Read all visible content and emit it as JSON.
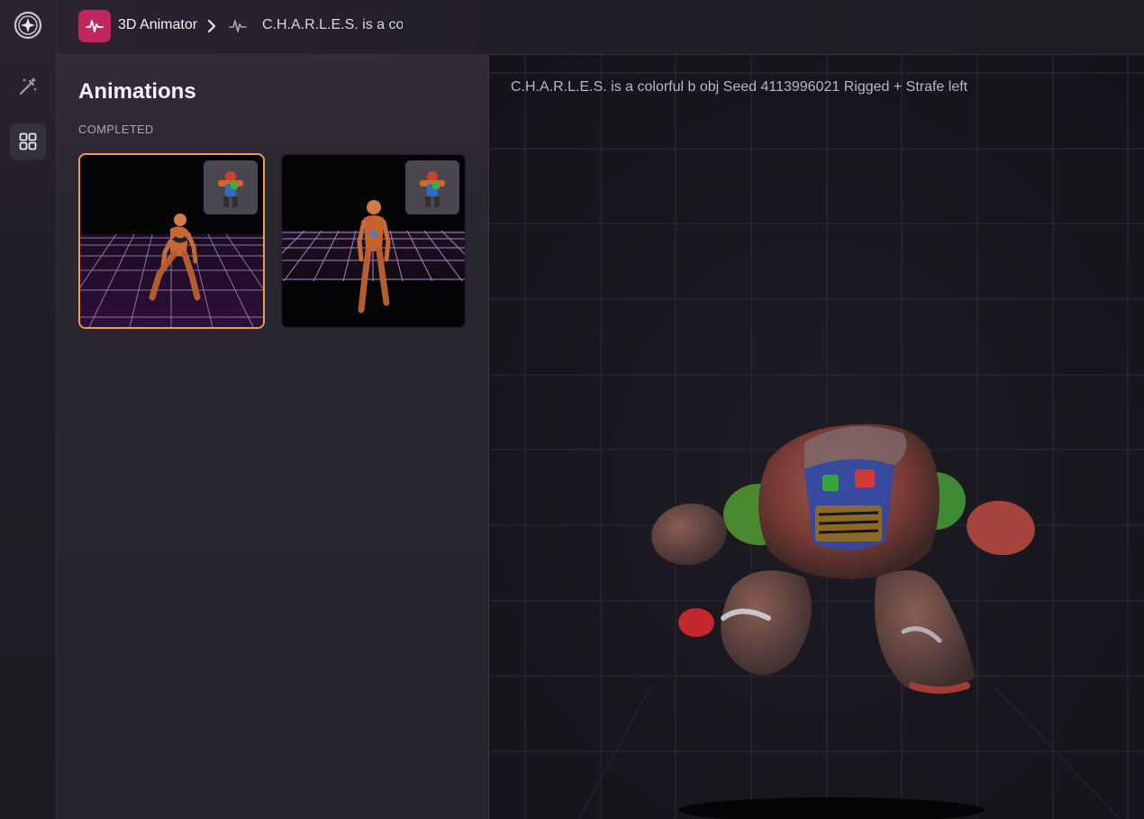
{
  "rail": {
    "items": [
      {
        "icon": "logo-compass-icon",
        "active": false
      },
      {
        "icon": "magic-wand-icon",
        "active": false
      },
      {
        "icon": "grid-icon",
        "active": true
      }
    ]
  },
  "topbar": {
    "app_icon": "waveform-icon",
    "app_title": "3D Animator",
    "separator_icon": "chevron-right-icon",
    "crumb_icon": "waveform-icon",
    "crumb_text": "C.H.A.R.L.E.S. is a colorful"
  },
  "panel": {
    "title": "Animations",
    "section_label": "COMPLETED",
    "cards": [
      {
        "selected": true,
        "thumb_icon": "character-thumbnail"
      },
      {
        "selected": false,
        "thumb_icon": "character-thumbnail"
      }
    ]
  },
  "viewport": {
    "caption": "C.H.A.R.L.E.S. is a colorful b obj Seed 4113996021 Rigged + Strafe left"
  },
  "colors": {
    "accent": "#f39a4c",
    "app_badge": "#c2255c",
    "background": "#17151d"
  }
}
